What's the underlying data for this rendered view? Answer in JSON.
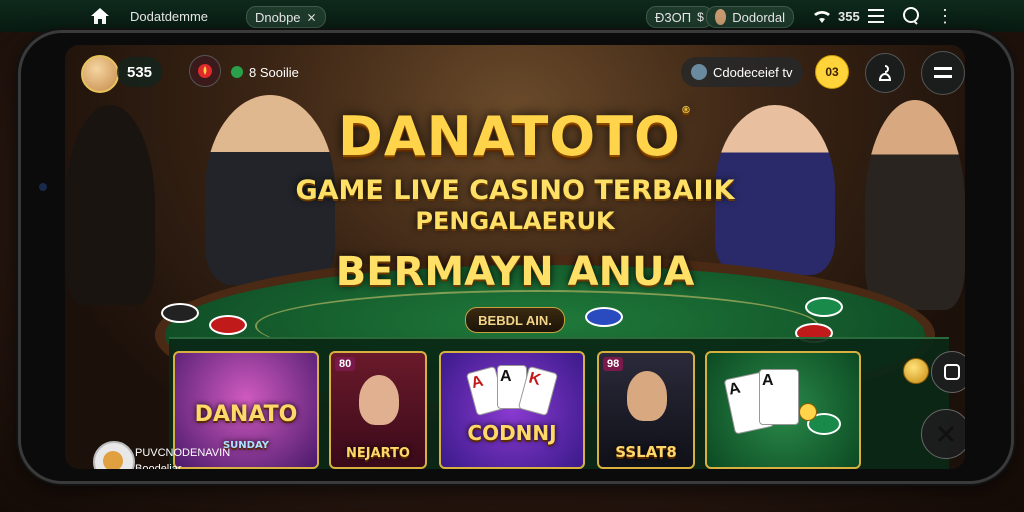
{
  "statusbar": {
    "home_icon": "home-icon",
    "title": "Dоdаtdemme",
    "tab_label": "Dnobpe",
    "tab_icon": "close-icon",
    "counter": "Ð3OП",
    "counter_icon": "dollar-icon",
    "user_name": "Dodordal",
    "signal": "355",
    "wifi_icon": "wifi-icon"
  },
  "app": {
    "balance": "535",
    "coins_label": "8 Sooilie",
    "search_label": "Cdodeceief tv",
    "coin_badge": "03"
  },
  "hero": {
    "brand": "DANATOTO",
    "brand_mark": "®",
    "line1": "GAME LIVE CASINO TERBAIIK",
    "line2": "PENGALAERUK",
    "line3": "BERMAYN ANUA",
    "banner": "BEBDL AIN."
  },
  "games": [
    {
      "title": "DANATO",
      "sub": "SUNDAY"
    },
    {
      "title": "NEJARTO",
      "badge": "80"
    },
    {
      "title": "CODNNJ"
    },
    {
      "title": "SSLAT8",
      "badge": "98"
    },
    {
      "title": ""
    }
  ],
  "footer": {
    "line1": "PUVCNODENAVIN",
    "line2": "Boodeliar"
  },
  "colors": {
    "accent_gold": "#ffd44a",
    "felt_green": "#13562a",
    "status_bg": "#0e2a1c"
  }
}
